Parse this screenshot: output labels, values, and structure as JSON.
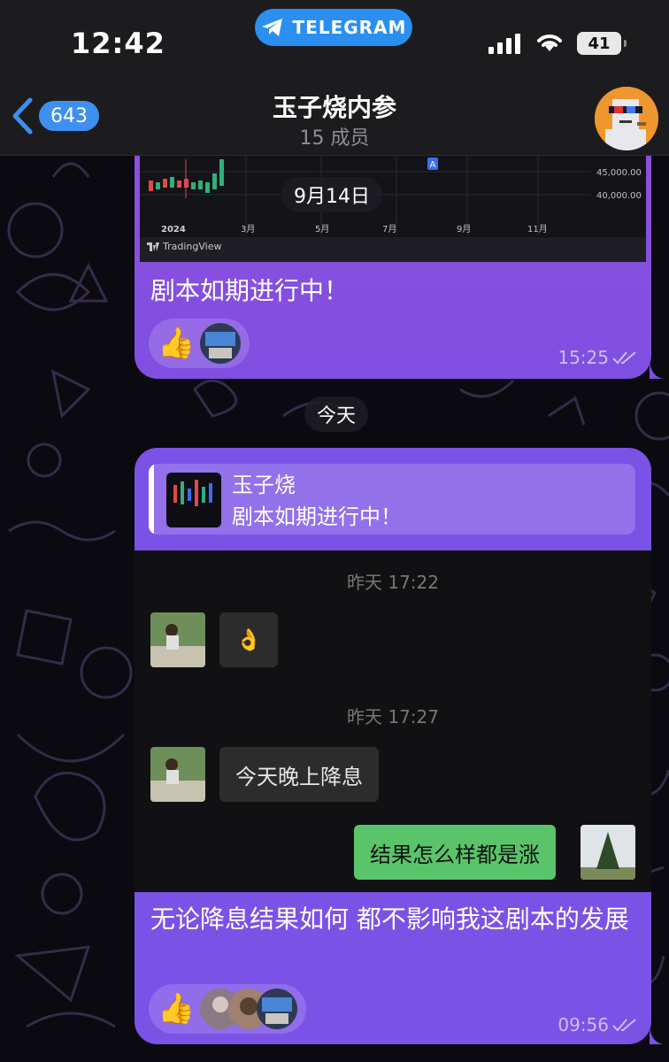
{
  "status_bar": {
    "time": "12:42",
    "app_pill": "TELEGRAM",
    "battery": "41"
  },
  "header": {
    "back_count": "643",
    "title": "玉子烧内参",
    "subtitle": "15 成员"
  },
  "messages": [
    {
      "chart_preview": {
        "year_label": "2024",
        "month_ticks": [
          "3月",
          "5月",
          "7月",
          "9月",
          "11月"
        ],
        "price_ticks": [
          "45,000.00",
          "40,000.00"
        ],
        "marker": "A",
        "brand": "TradingView"
      },
      "text": "剧本如期进行中！",
      "time": "15:25",
      "reactions": [
        "thumbs-up",
        "avatar"
      ]
    },
    {
      "reply": {
        "author": "玉子烧",
        "text": "剧本如期进行中！"
      },
      "screenshot": {
        "time_1": "昨天 17:22",
        "msg_1": "👌",
        "time_2": "昨天 17:27",
        "msg_2": "今天晚上降息",
        "msg_3": "结果怎么样都是涨"
      },
      "text": "无论降息结果如何 都不影响我这剧本的发展",
      "time": "09:56",
      "reactions": [
        "thumbs-up",
        "avatar",
        "avatar",
        "avatar"
      ]
    }
  ],
  "floating_date": "9月14日",
  "date_separator": "今天",
  "colors": {
    "bubble_purple": "#7b52e6",
    "telegram_blue": "#2a8ff0",
    "wechat_green": "#5ac46a"
  }
}
